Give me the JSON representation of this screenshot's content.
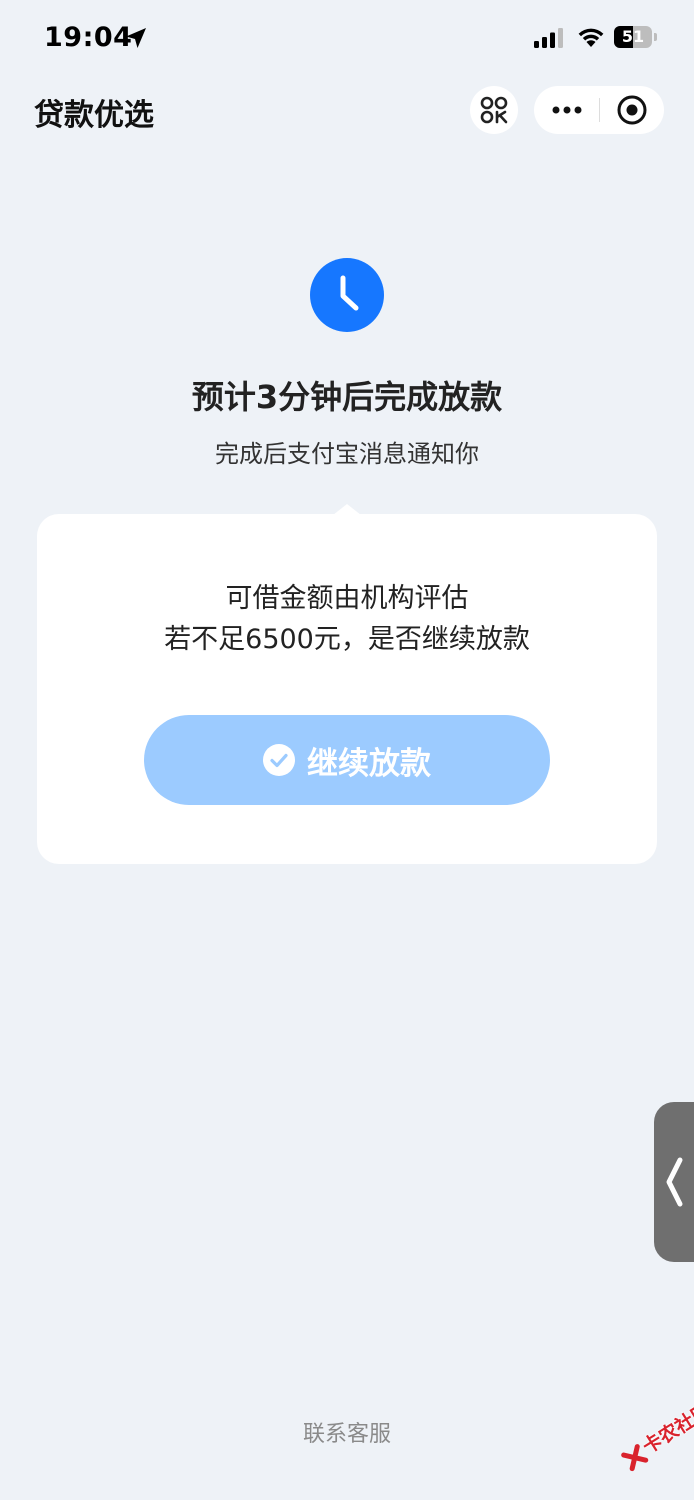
{
  "status_bar": {
    "time": "19:04",
    "battery_level": "51"
  },
  "nav": {
    "title": "贷款优选"
  },
  "main": {
    "headline": "预计3分钟后完成放款",
    "subline": "完成后支付宝消息通知你"
  },
  "card": {
    "line1": "可借金额由机构评估",
    "line2": "若不足6500元，是否继续放款",
    "button_label": "继续放款"
  },
  "footer": {
    "contact_label": "联系客服"
  },
  "watermark": {
    "text": "卡农社区"
  },
  "colors": {
    "background": "#eef2f7",
    "accent_blue": "#1677ff",
    "button_disabled": "#9ccbff"
  },
  "icons": {
    "status": [
      "location-arrow-icon",
      "signal-icon",
      "wifi-icon",
      "battery-icon"
    ],
    "nav": [
      "scan-icon",
      "more-icon",
      "close-icon"
    ],
    "main": [
      "clock-icon",
      "check-icon",
      "chevron-left-icon"
    ]
  }
}
